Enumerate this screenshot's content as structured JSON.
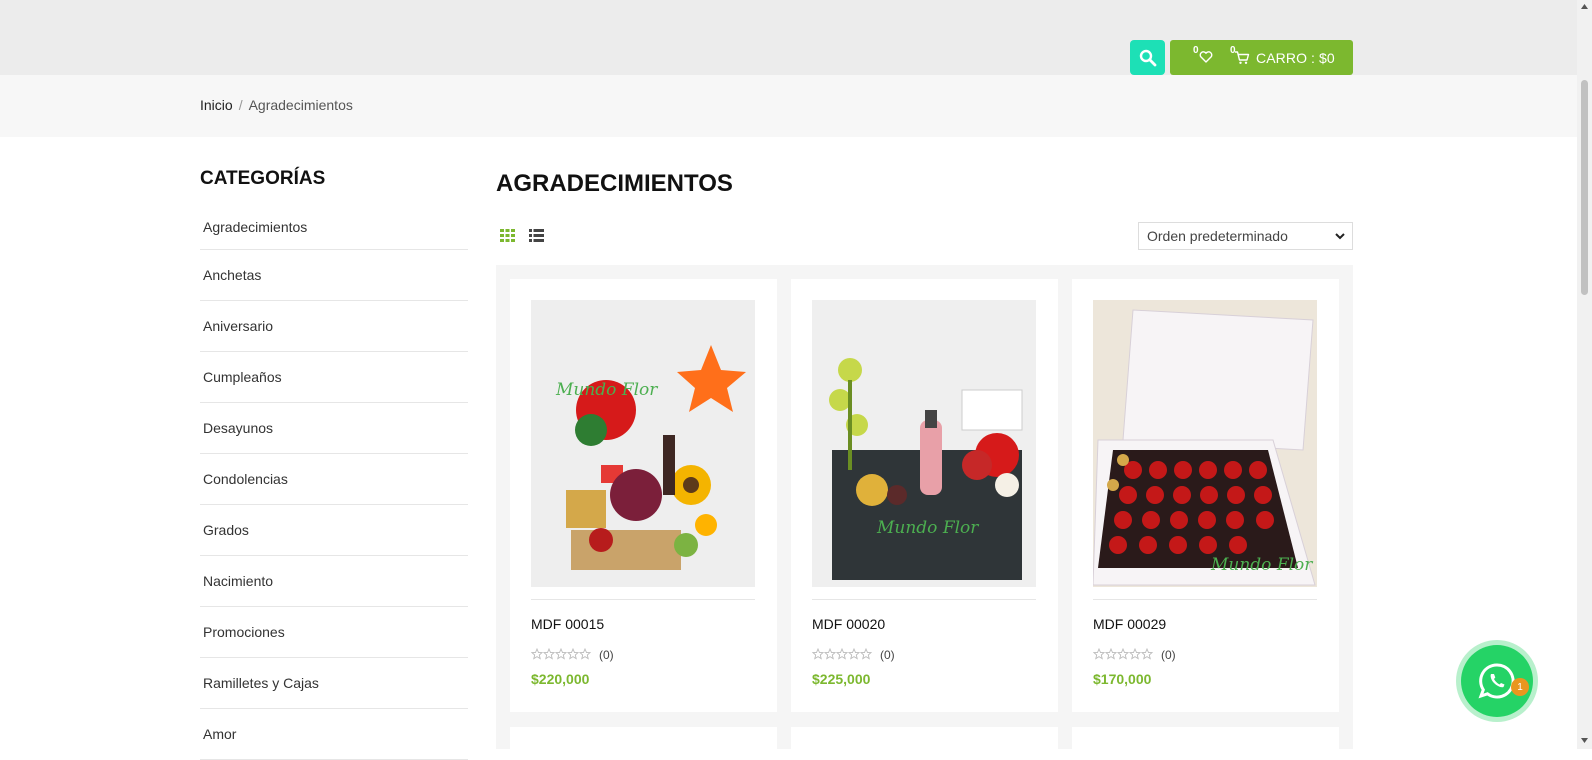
{
  "header": {
    "wishlist_count": "0",
    "cart_count": "0",
    "cart_label": "CARRO : $0",
    "colors": {
      "search_bg": "#1de0b6",
      "cart_bg": "#7cb82f",
      "price": "#7cb82f"
    }
  },
  "breadcrumb": {
    "home": "Inicio",
    "separator": "/",
    "current": "Agradecimientos"
  },
  "sidebar": {
    "title": "CATEGORÍAS",
    "items": [
      {
        "label": "Agradecimientos"
      },
      {
        "label": "Anchetas"
      },
      {
        "label": "Aniversario"
      },
      {
        "label": "Cumpleaños"
      },
      {
        "label": "Desayunos"
      },
      {
        "label": "Condolencias"
      },
      {
        "label": "Grados"
      },
      {
        "label": "Nacimiento"
      },
      {
        "label": "Promociones"
      },
      {
        "label": "Ramilletes y Cajas"
      },
      {
        "label": "Amor"
      }
    ]
  },
  "main": {
    "title": "AGRADECIMIENTOS",
    "sort": {
      "selected": "Orden predeterminado"
    },
    "products": [
      {
        "name": "MDF 00015",
        "rating_count": "(0)",
        "price": "$220,000",
        "rating": 0,
        "watermark": "Mundo Flor"
      },
      {
        "name": "MDF 00020",
        "rating_count": "(0)",
        "price": "$225,000",
        "rating": 0,
        "watermark": "Mundo Flor"
      },
      {
        "name": "MDF 00029",
        "rating_count": "(0)",
        "price": "$170,000",
        "rating": 0,
        "watermark": "Mundo Flor"
      }
    ]
  },
  "whatsapp": {
    "badge": "1",
    "icon": "whatsapp-icon"
  }
}
